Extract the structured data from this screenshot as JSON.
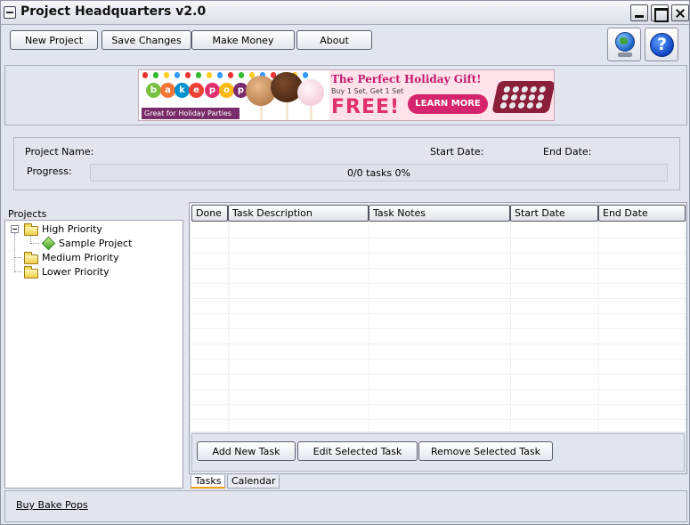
{
  "window": {
    "title": "Project Headquarters v2.0"
  },
  "toolbar": {
    "new_project": "New Project",
    "save_changes": "Save Changes",
    "make_money": "Make Money",
    "about": "About",
    "help_glyph": "?"
  },
  "banner": {
    "logo_letters": [
      "b",
      "a",
      "k",
      "e",
      "p",
      "o",
      "p"
    ],
    "tagline": "Great for Holiday Parties",
    "headline": "The Perfect Holiday Gift!",
    "subline": "Buy 1 Set, Get 1 Set",
    "free": "FREE!",
    "cta": "LEARN MORE",
    "colors": {
      "pink": "#e0306e",
      "magenta": "#c2186c",
      "purple": "#7a2c6a",
      "tray": "#8b1f3a"
    }
  },
  "project_info": {
    "name_label": "Project Name:",
    "start_label": "Start Date:",
    "end_label": "End Date:",
    "progress_label": "Progress:",
    "progress_text": "0/0 tasks  0%",
    "progress_fraction": 0
  },
  "projects": {
    "label": "Projects",
    "nodes": [
      {
        "label": "High Priority",
        "icon": "folder-icon",
        "expanded": true
      },
      {
        "label": "Sample Project",
        "icon": "project-leaf-icon"
      },
      {
        "label": "Medium Priority",
        "icon": "folder-icon"
      },
      {
        "label": "Lower Priority",
        "icon": "folder-icon"
      }
    ]
  },
  "tasks": {
    "columns": [
      "Done",
      "Task Description",
      "Task Notes",
      "Start Date",
      "End Date"
    ],
    "rows": [],
    "add_button": "Add New Task",
    "edit_button": "Edit Selected Task",
    "remove_button": "Remove Selected Task"
  },
  "tabs": [
    {
      "label": "Tasks",
      "active": true
    },
    {
      "label": "Calendar",
      "active": false
    }
  ],
  "statusbar": {
    "link": "Buy Bake Pops"
  },
  "icons": {
    "globe": "globe-icon",
    "help": "help-icon",
    "system_menu": "system-menu-icon"
  }
}
